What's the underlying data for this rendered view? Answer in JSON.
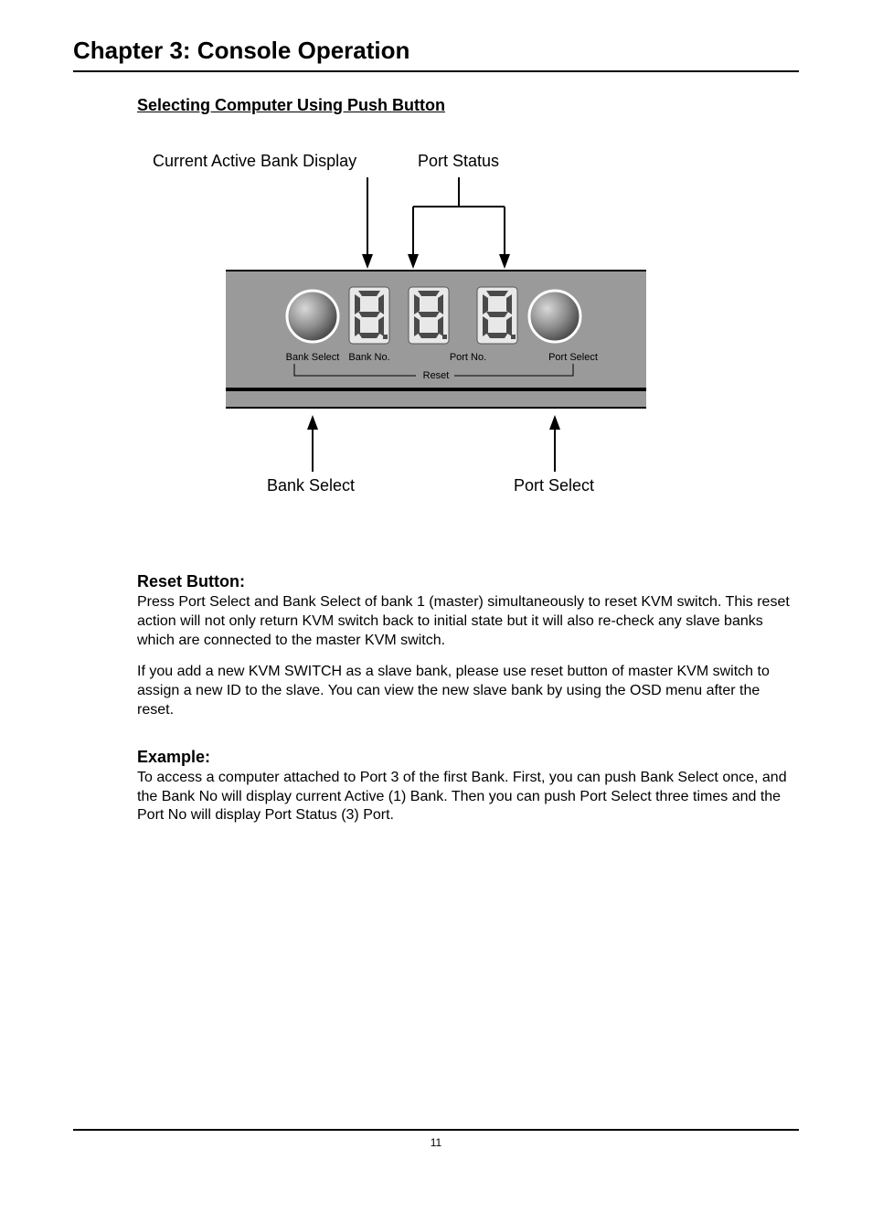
{
  "chapter_title": "Chapter 3: Console Operation",
  "section_title": "Selecting Computer Using Push Button",
  "diagram": {
    "top_labels": {
      "active_bank": "Current Active Bank Display",
      "port_status": "Port Status"
    },
    "panel_labels": {
      "bank_select": "Bank Select",
      "bank_no": "Bank No.",
      "port_no": "Port No.",
      "port_select": "Port Select",
      "reset": "Reset"
    },
    "bottom_labels": {
      "bank_select": "Bank Select",
      "port_select": "Port Select"
    },
    "digits": [
      "8.",
      "8.",
      "8."
    ]
  },
  "sections": [
    {
      "heading": "Reset Button:",
      "paragraphs": [
        "Press Port Select and Bank Select of bank 1 (master) simultaneously to reset KVM switch. This reset action will not only return KVM switch back to initial state but it will also re-check any slave banks which are connected to the master KVM switch.",
        "If you add a new KVM SWITCH as a slave bank, please use reset button of master KVM switch to assign a new ID to the slave. You can view the new slave bank by using the OSD menu after the reset."
      ]
    },
    {
      "heading": "Example:",
      "paragraphs": [
        "To access a computer attached to Port 3 of the first Bank. First, you can push Bank Select once, and the Bank No will display current Active (1) Bank. Then you can push Port Select three times and the Port No will display Port Status (3) Port."
      ]
    }
  ],
  "page_number": "11"
}
